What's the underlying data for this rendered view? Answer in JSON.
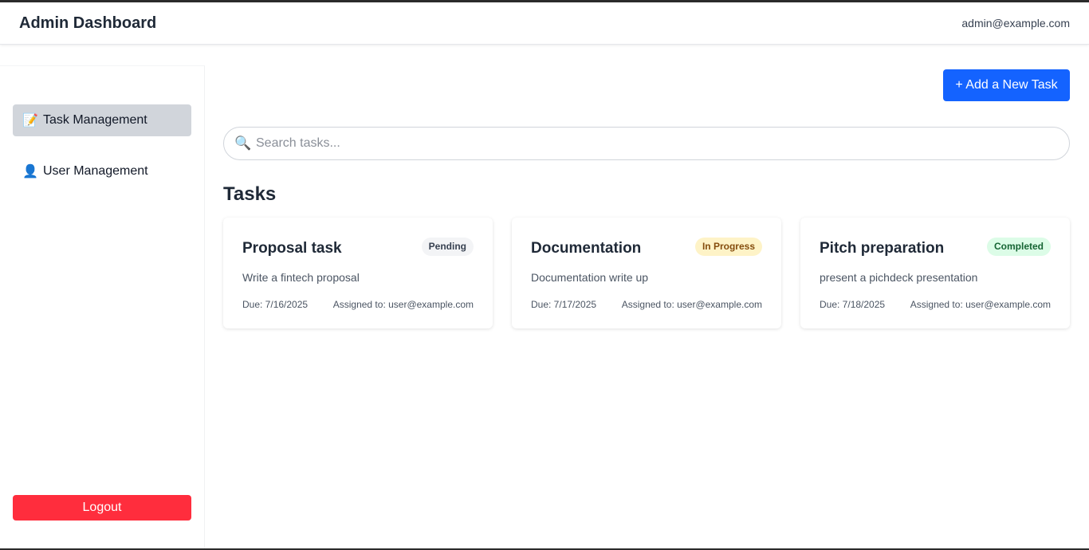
{
  "header": {
    "title": "Admin Dashboard",
    "user_email": "admin@example.com"
  },
  "sidebar": {
    "items": [
      {
        "label": "Task Management",
        "icon": "memo-icon",
        "glyph": "📝",
        "active": true
      },
      {
        "label": "User Management",
        "icon": "user-icon",
        "glyph": "👤",
        "active": false
      }
    ],
    "logout_label": "Logout"
  },
  "main": {
    "add_button_label": "+ Add a New Task",
    "search": {
      "placeholder": "Search tasks...",
      "value": "",
      "icon": "search-icon",
      "glyph": "🔍"
    },
    "section_title": "Tasks",
    "tasks": [
      {
        "title": "Proposal task",
        "status": "Pending",
        "description": "Write a fintech proposal",
        "due": "Due: 7/16/2025",
        "assigned": "Assigned to: user@example.com"
      },
      {
        "title": "Documentation",
        "status": "In Progress",
        "description": "Documentation write up",
        "due": "Due: 7/17/2025",
        "assigned": "Assigned to: user@example.com"
      },
      {
        "title": "Pitch preparation",
        "status": "Completed",
        "description": "present a pichdeck presentation",
        "due": "Due: 7/18/2025",
        "assigned": "Assigned to: user@example.com"
      }
    ]
  },
  "colors": {
    "primary": "#1463ff",
    "danger": "#ff2d3d",
    "active_nav": "#d1d5db",
    "pending_bg": "#f3f4f6",
    "progress_bg": "#fef3c7",
    "completed_bg": "#dcfce7"
  }
}
